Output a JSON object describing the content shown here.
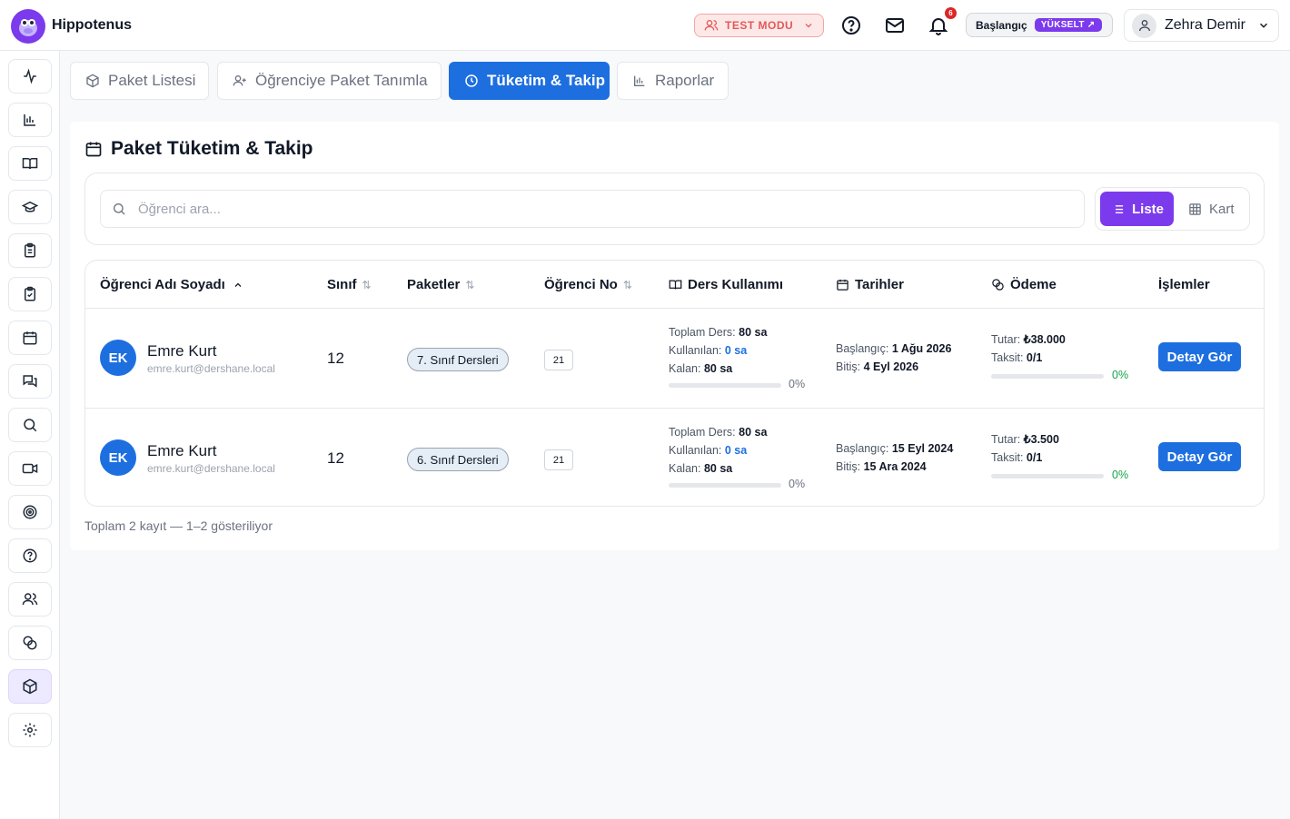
{
  "app": {
    "name": "Hippotenus"
  },
  "topbar": {
    "test_mode_label": "TEST MODU",
    "notification_count": "6",
    "plan_label": "Başlangıç",
    "upgrade_label": "YÜKSELT ↗",
    "user_name": "Zehra Demir"
  },
  "sidebar": {
    "items": [
      {
        "icon": "activity-icon",
        "active": false
      },
      {
        "icon": "bar-chart-icon",
        "active": false
      },
      {
        "icon": "book-open-icon",
        "active": false
      },
      {
        "icon": "graduation-cap-icon",
        "active": false
      },
      {
        "icon": "clipboard-list-icon",
        "active": false
      },
      {
        "icon": "clipboard-check-icon",
        "active": false
      },
      {
        "icon": "calendar-icon",
        "active": false
      },
      {
        "icon": "messages-icon",
        "active": false
      },
      {
        "icon": "search-icon",
        "active": false
      },
      {
        "icon": "video-icon",
        "active": false
      },
      {
        "icon": "target-icon",
        "active": false
      },
      {
        "icon": "help-circle-icon",
        "active": false
      },
      {
        "icon": "users-icon",
        "active": false
      },
      {
        "icon": "coins-icon",
        "active": false
      },
      {
        "icon": "package-icon",
        "active": true
      },
      {
        "icon": "settings-icon",
        "active": false
      }
    ]
  },
  "tabs": [
    {
      "label": "Paket Listesi",
      "icon": "package-icon",
      "active": false
    },
    {
      "label": "Öğrenciye Paket Tanımla",
      "icon": "user-plus-icon",
      "active": false
    },
    {
      "label": "Tüketim & Takip",
      "icon": "clock-icon",
      "active": true
    },
    {
      "label": "Raporlar",
      "icon": "bar-chart-icon",
      "active": false
    }
  ],
  "page": {
    "title": "Paket Tüketim & Takip",
    "search_placeholder": "Öğrenci ara...",
    "view_list_label": "Liste",
    "view_card_label": "Kart"
  },
  "table": {
    "headers": {
      "name": "Öğrenci Adı Soyadı",
      "grade": "Sınıf",
      "packages": "Paketler",
      "student_no": "Öğrenci No",
      "usage": "Ders Kullanımı",
      "dates": "Tarihler",
      "payment": "Ödeme",
      "actions": "İşlemler"
    },
    "labels": {
      "total": "Toplam Ders:",
      "used": "Kullanılan:",
      "remaining": "Kalan:",
      "start": "Başlangıç:",
      "end": "Bitiş:",
      "amount": "Tutar:",
      "installment": "Taksit:",
      "detail_button": "Detay Gör"
    },
    "rows": [
      {
        "initials": "EK",
        "name": "Emre Kurt",
        "email": "emre.kurt@dershane.local",
        "grade": "12",
        "package": "7. Sınıf Dersleri",
        "student_no": "21",
        "total": "80 sa",
        "used": "0 sa",
        "remaining": "80 sa",
        "usage_pct": "0%",
        "usage_progress": 0,
        "start": "1 Ağu 2026",
        "end": "4 Eyl 2026",
        "amount": "₺38.000",
        "installment": "0/1",
        "pay_pct": "0%",
        "pay_progress": 0
      },
      {
        "initials": "EK",
        "name": "Emre Kurt",
        "email": "emre.kurt@dershane.local",
        "grade": "12",
        "package": "6. Sınıf Dersleri",
        "student_no": "21",
        "total": "80 sa",
        "used": "0 sa",
        "remaining": "80 sa",
        "usage_pct": "0%",
        "usage_progress": 0,
        "start": "15 Eyl 2024",
        "end": "15 Ara 2024",
        "amount": "₺3.500",
        "installment": "0/1",
        "pay_pct": "0%",
        "pay_progress": 0
      }
    ]
  },
  "footer": {
    "summary": "Toplam 2 kayıt — 1–2 gösteriliyor"
  },
  "colors": {
    "primary": "#1d6fe0",
    "accent": "#7c3aed",
    "success": "#16a34a",
    "danger": "#dc2626"
  }
}
